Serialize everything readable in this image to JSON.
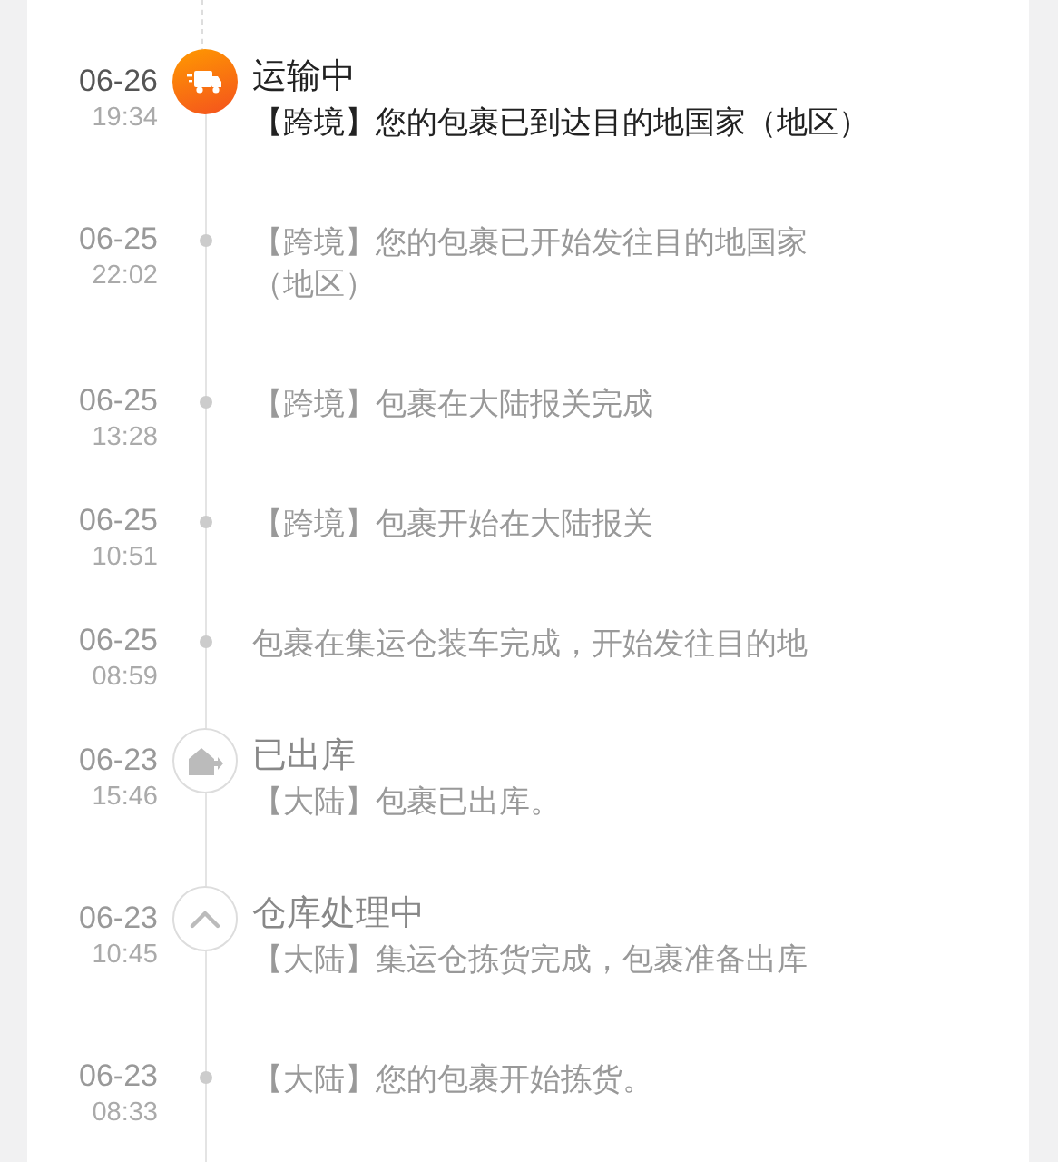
{
  "events": [
    {
      "date": "06-26",
      "time": "19:34",
      "kind": "transit",
      "current": true,
      "title": "运输中",
      "lines": [
        "【跨境】您的包裹已到达目的地国家（地区）"
      ]
    },
    {
      "date": "06-25",
      "time": "22:02",
      "kind": "update",
      "current": false,
      "lines": [
        "【跨境】您的包裹已开始发往目的地国家",
        "（地区）"
      ]
    },
    {
      "date": "06-25",
      "time": "13:28",
      "kind": "update",
      "current": false,
      "lines": [
        "【跨境】包裹在大陆报关完成"
      ]
    },
    {
      "date": "06-25",
      "time": "10:51",
      "kind": "update",
      "current": false,
      "lines": [
        "【跨境】包裹开始在大陆报关"
      ]
    },
    {
      "date": "06-25",
      "time": "08:59",
      "kind": "update",
      "current": false,
      "lines": [
        "包裹在集运仓装车完成，开始发往目的地"
      ]
    },
    {
      "date": "06-23",
      "time": "15:46",
      "kind": "shipped",
      "current": false,
      "title": "已出库",
      "lines": [
        "【大陆】包裹已出库。"
      ]
    },
    {
      "date": "06-23",
      "time": "10:45",
      "kind": "processing",
      "current": false,
      "title": "仓库处理中",
      "lines": [
        "【大陆】集运仓拣货完成，包裹准备出库"
      ]
    },
    {
      "date": "06-23",
      "time": "08:33",
      "kind": "update",
      "current": false,
      "lines": [
        "【大陆】您的包裹开始拣货。"
      ]
    }
  ]
}
